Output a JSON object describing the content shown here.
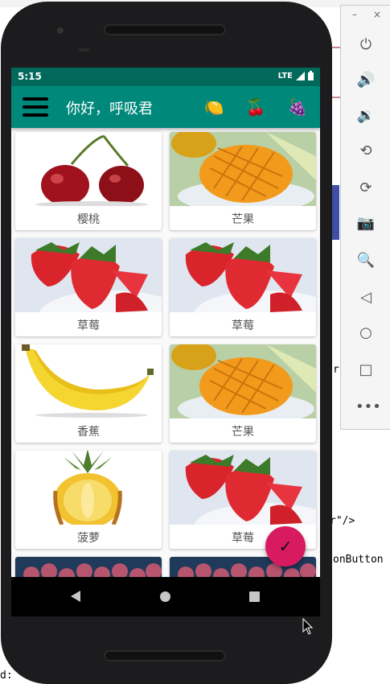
{
  "ide": {
    "tab_fragment": "d  ",
    "code_line_1": "r\"/>",
    "code_line_2": "onButton",
    "code_line_3": "r",
    "code_line_4": "d:"
  },
  "status_bar": {
    "time": "5:15",
    "network": "LTE"
  },
  "app_bar": {
    "title": "你好，呼吸君",
    "actions": [
      {
        "icon": "lemon-icon",
        "glyph": "🍋"
      },
      {
        "icon": "cherry-icon",
        "glyph": "🍒"
      },
      {
        "icon": "grapes-icon",
        "glyph": "🍇"
      }
    ]
  },
  "fruits": [
    {
      "name": "樱桃",
      "image": "cherry"
    },
    {
      "name": "芒果",
      "image": "mango"
    },
    {
      "name": "草莓",
      "image": "strawberry"
    },
    {
      "name": "草莓",
      "image": "strawberry"
    },
    {
      "name": "香蕉",
      "image": "banana"
    },
    {
      "name": "芒果",
      "image": "mango"
    },
    {
      "name": "菠萝",
      "image": "pineapple"
    },
    {
      "name": "草莓",
      "image": "strawberry"
    },
    {
      "name": "",
      "image": "grapes"
    },
    {
      "name": "",
      "image": "grapes"
    }
  ],
  "fab": {
    "glyph": "✓"
  },
  "emulator_controls": [
    "power-icon",
    "volume-up-icon",
    "volume-down-icon",
    "rotate-left-icon",
    "rotate-right-icon",
    "camera-icon",
    "zoom-icon",
    "back-icon",
    "home-icon",
    "overview-icon",
    "more-icon"
  ],
  "colors": {
    "primary": "#00897b",
    "primary_dark": "#00695c",
    "accent": "#d81b60"
  }
}
